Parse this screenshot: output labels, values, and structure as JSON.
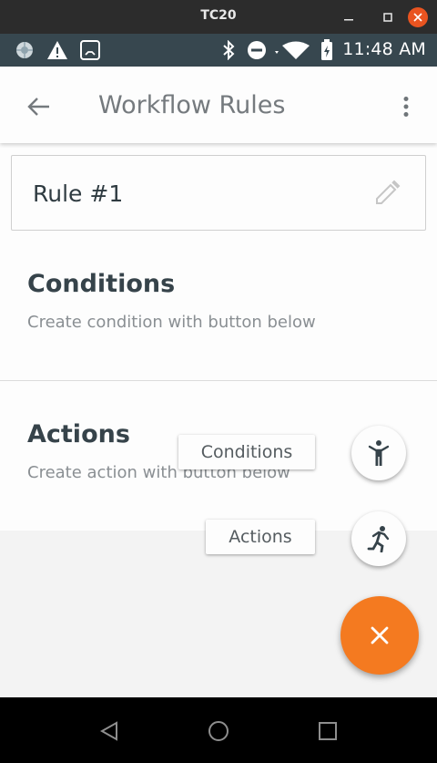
{
  "window": {
    "title": "TC20"
  },
  "statusbar": {
    "time": "11:48 AM",
    "icons": [
      "aperture-icon",
      "warning-icon",
      "tablet-icon",
      "bluetooth-icon",
      "do-not-disturb-icon",
      "wifi-icon",
      "battery-charging-icon"
    ]
  },
  "appbar": {
    "title": "Workflow Rules"
  },
  "rule": {
    "name": "Rule #1"
  },
  "conditions": {
    "title": "Conditions",
    "hint": "Create condition with button below"
  },
  "actions": {
    "title": "Actions",
    "hint": "Create action with button below"
  },
  "fab_menu": {
    "conditions_label": "Conditions",
    "actions_label": "Actions"
  },
  "colors": {
    "accent": "#f47a20",
    "statusbar": "#37474f",
    "titlebar": "#2c2c2c"
  }
}
